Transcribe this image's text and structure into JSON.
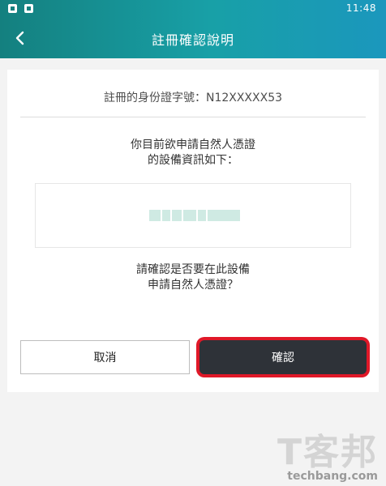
{
  "status_bar": {
    "time": "11:48",
    "icons": [
      "notification-icon",
      "app-icon"
    ]
  },
  "app_bar": {
    "title": "註冊確認說明",
    "back_icon": "chevron-left-icon"
  },
  "card": {
    "id_line": "註冊的身份證字號：N12XXXXX53",
    "message_1_line_1": "你目前欲申請自然人憑證",
    "message_1_line_2": "的設備資訊如下：",
    "message_2_line_1": "請確認是否要在此設備",
    "message_2_line_2": "申請自然人憑證？",
    "buttons": {
      "cancel": "取消",
      "confirm": "確認"
    }
  },
  "colors": {
    "header_gradient": [
      "#14807f",
      "#18a0a7",
      "#1b97bd"
    ],
    "confirm_button": "#2e3238",
    "highlight": "#e01828"
  },
  "watermark": {
    "title": "T客邦",
    "site": "techbang.com"
  }
}
